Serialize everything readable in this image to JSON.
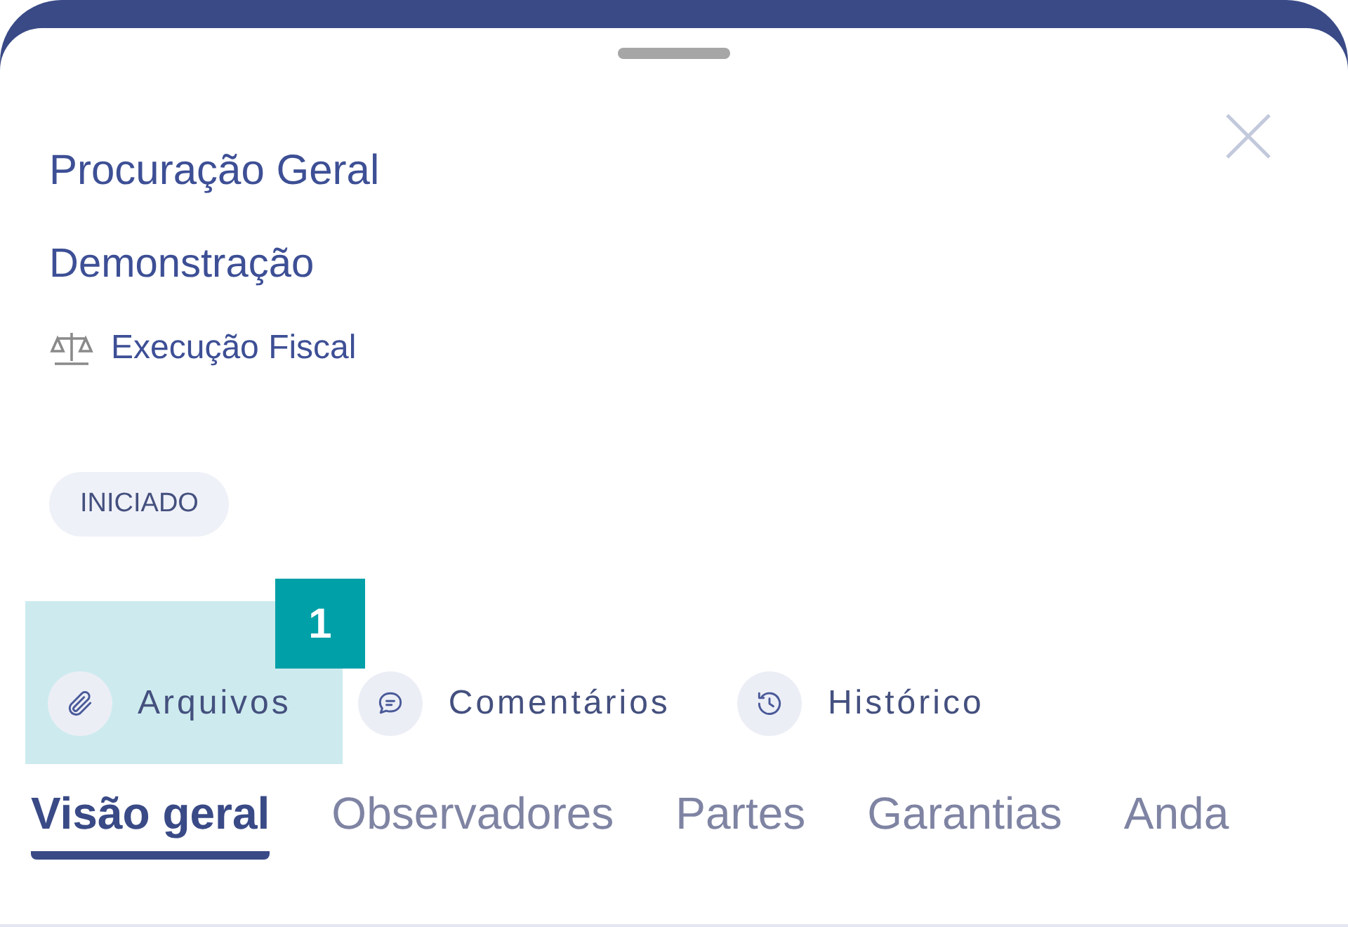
{
  "sheet": {
    "title": "Procuração Geral",
    "subtitle": "Demonstração",
    "category": "Execução Fiscal",
    "status": "INICIADO"
  },
  "actions": [
    {
      "kind": "attachment",
      "label": "Arquivos",
      "highlighted": true,
      "marker": "1"
    },
    {
      "kind": "comment",
      "label": "Comentários",
      "highlighted": false
    },
    {
      "kind": "history",
      "label": "Histórico",
      "highlighted": false
    }
  ],
  "tabs": [
    {
      "label": "Visão geral",
      "selected": true
    },
    {
      "label": "Observadores",
      "selected": false
    },
    {
      "label": "Partes",
      "selected": false
    },
    {
      "label": "Garantias",
      "selected": false
    },
    {
      "label": "Anda",
      "selected": false
    }
  ]
}
